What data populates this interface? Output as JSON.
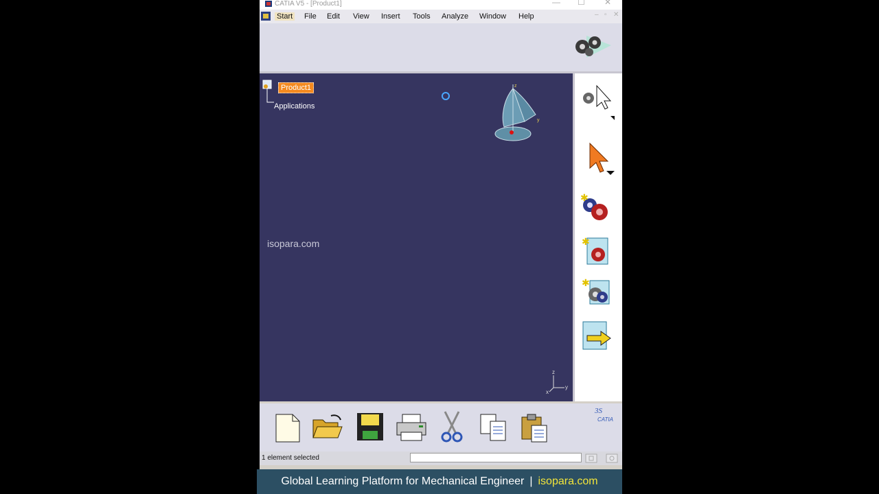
{
  "window": {
    "title": "CATIA V5 - [Product1]",
    "controls": {
      "minimize": "—",
      "maximize": "☐",
      "close": "✕"
    },
    "mdi_controls": {
      "minimize": "–",
      "restore": "▫",
      "close": "✕"
    }
  },
  "menu": [
    {
      "label": "Start",
      "active": true
    },
    {
      "label": "File"
    },
    {
      "label": "Edit"
    },
    {
      "label": "View"
    },
    {
      "label": "Insert"
    },
    {
      "label": "Tools"
    },
    {
      "label": "Analyze"
    },
    {
      "label": "Window"
    },
    {
      "label": "Help"
    }
  ],
  "tree": {
    "root": "Product1",
    "child": "Applications"
  },
  "viewport": {
    "watermark": "isopara.com",
    "compass_z": "z",
    "compass_y": "y",
    "axis_z": "z",
    "axis_x": "x",
    "axis_y": "y"
  },
  "right_toolbar": [
    {
      "name": "select-cursor-icon"
    },
    {
      "name": "select-arrow-icon"
    },
    {
      "name": "new-assembly-icon"
    },
    {
      "name": "insert-product-icon"
    },
    {
      "name": "insert-component-icon"
    },
    {
      "name": "existing-component-icon"
    }
  ],
  "bottom_toolbar": [
    {
      "name": "new-document-icon"
    },
    {
      "name": "open-folder-icon"
    },
    {
      "name": "save-icon"
    },
    {
      "name": "print-icon"
    },
    {
      "name": "cut-icon"
    },
    {
      "name": "copy-icon"
    },
    {
      "name": "paste-icon"
    }
  ],
  "brand": {
    "label": "CATIA"
  },
  "status": {
    "message": "1 element selected",
    "command_value": ""
  },
  "banner": {
    "text": "Global Learning Platform for Mechanical Engineer",
    "separator": "|",
    "site": "isopara.com"
  },
  "colors": {
    "viewport_bg": "#363560",
    "tree_highlight": "#f58a1f",
    "banner_bg": "#2c4f63",
    "banner_accent": "#f3e53a"
  }
}
